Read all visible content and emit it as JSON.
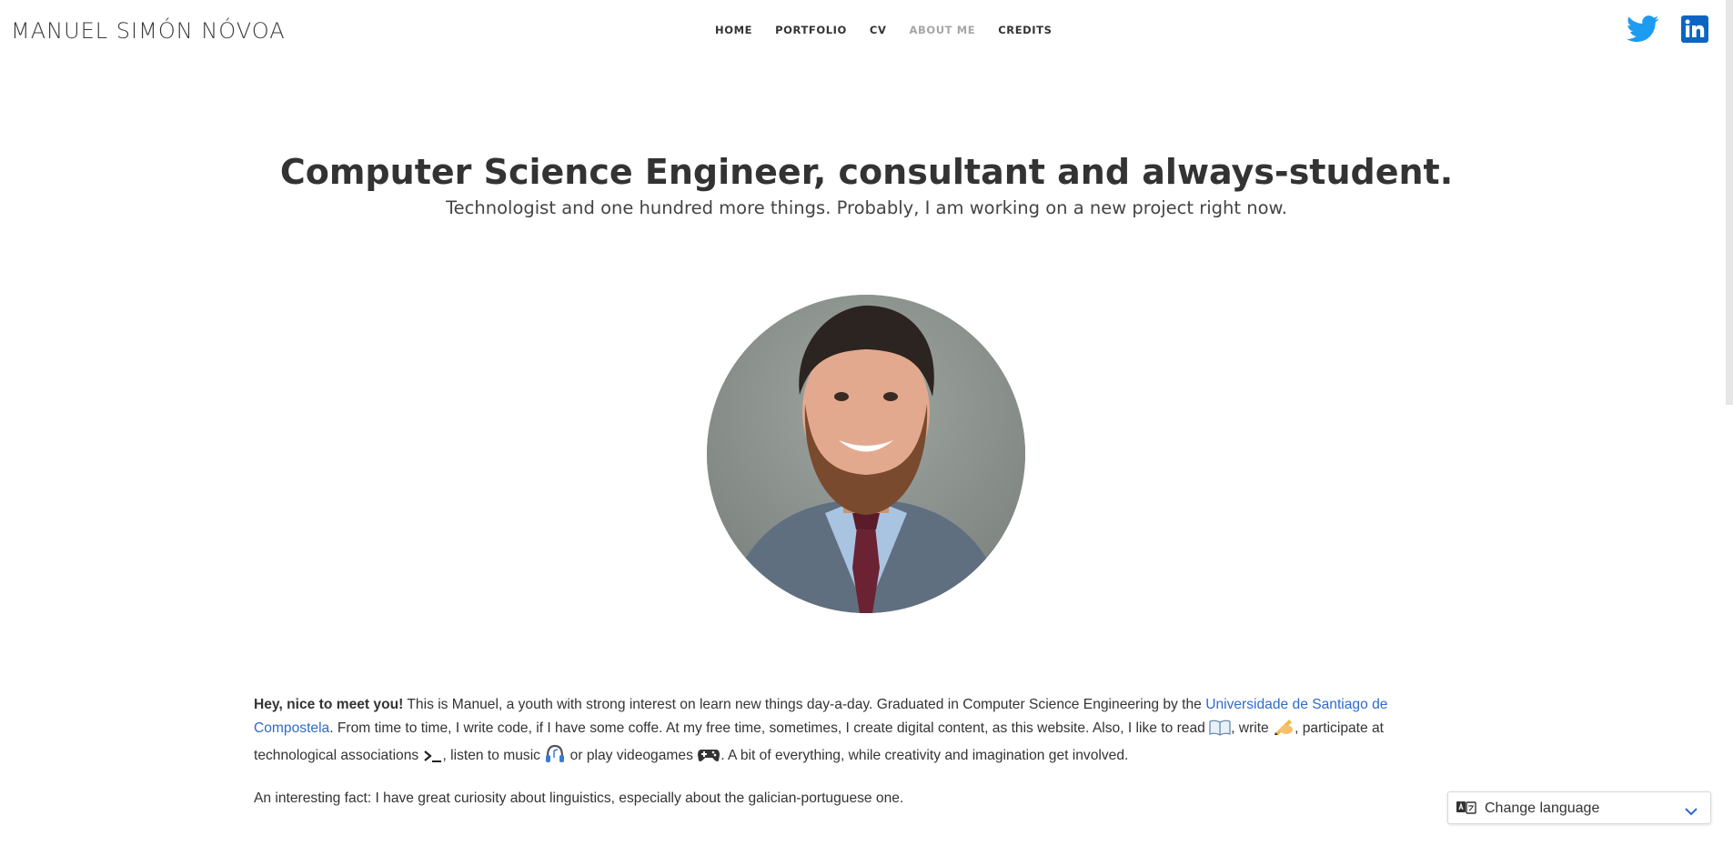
{
  "header": {
    "brand": "MANUEL SIMÓN NÓVOA",
    "nav": [
      "HOME",
      "PORTFOLIO",
      "CV",
      "ABOUT ME",
      "CREDITS"
    ],
    "active": "ABOUT ME",
    "social_icons": [
      "twitter-icon",
      "linkedin-icon"
    ]
  },
  "hero": {
    "title": "Computer Science Engineer, consultant and always-student.",
    "subtitle": "Technologist and one hundred more things. Probably, I am working on a new project right now."
  },
  "about": {
    "greeting": "Hey, nice to meet you!",
    "p1_a": " This is Manuel, a youth with strong interest on learn new things day-a-day. Graduated in Computer Science Engineering by the ",
    "university_link": "Universidade de Santiago de Compostela",
    "p1_b": ". From time to time, I write code, if I have some coffe. At my free time, sometimes, I create digital content, as this website. Also, I like to read ",
    "p1_c": ", write ",
    "p1_d": ", participate at technological associations ",
    "p1_e": ", listen to music ",
    "p1_f": " or play videogames ",
    "p1_g": ". A bit of everything, while creativity and imagination get involved.",
    "p2": "An interesting fact: I have great curiosity about linguistics, especially about the galician-portuguese one.",
    "emoji_icons": [
      "book-icon",
      "writing-hand-icon",
      "terminal-icon",
      "headphones-icon",
      "gamepad-icon"
    ]
  },
  "language": {
    "label": "Change language"
  },
  "colors": {
    "link": "#2f6bc8",
    "twitter": "#1d9bf0",
    "linkedin": "#0a66c2",
    "active_nav": "#a6a6a6"
  }
}
